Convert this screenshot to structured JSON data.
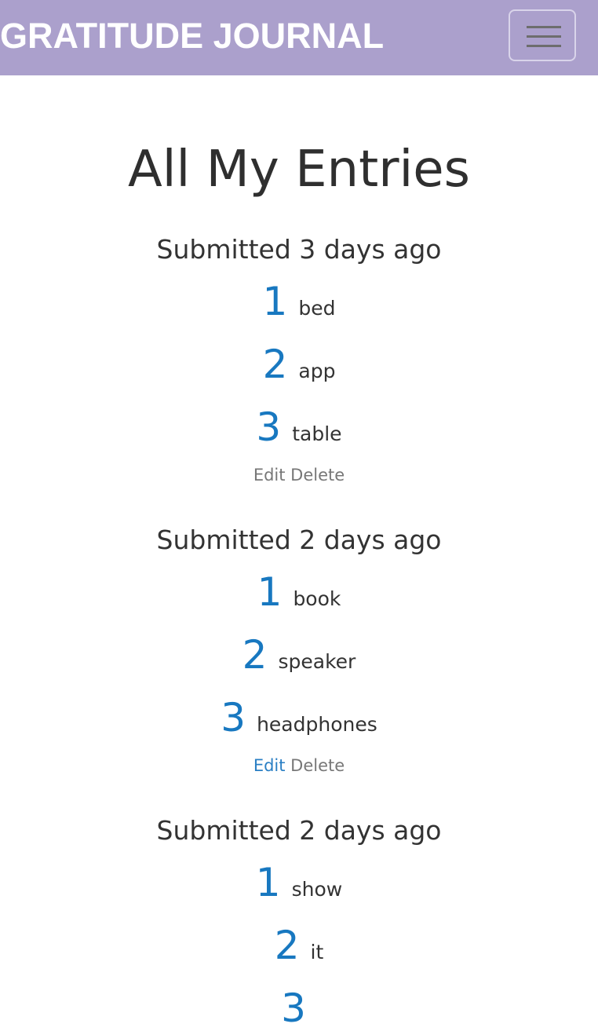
{
  "navbar": {
    "brand": "GRATITUDE JOURNAL",
    "toggler_icon": "hamburger-menu-icon"
  },
  "main": {
    "title": "All My Entries",
    "entries": [
      {
        "submitted": "Submitted 3 days ago",
        "items": [
          {
            "num": "1",
            "text": "bed"
          },
          {
            "num": "2",
            "text": "app"
          },
          {
            "num": "3",
            "text": "table"
          }
        ],
        "edit_label": "Edit",
        "delete_label": "Delete"
      },
      {
        "submitted": "Submitted 2 days ago",
        "items": [
          {
            "num": "1",
            "text": "book"
          },
          {
            "num": "2",
            "text": "speaker"
          },
          {
            "num": "3",
            "text": "headphones"
          }
        ],
        "edit_label": "Edit",
        "delete_label": "Delete"
      },
      {
        "submitted": "Submitted 2 days ago",
        "items": [
          {
            "num": "1",
            "text": "show"
          },
          {
            "num": "2",
            "text": "it"
          },
          {
            "num": "3",
            "text": ""
          }
        ]
      }
    ]
  },
  "colors": {
    "navbar_bg": "#aba0cc",
    "number_blue": "#1878c0",
    "edit_hover_blue": "#2a7fc4"
  }
}
